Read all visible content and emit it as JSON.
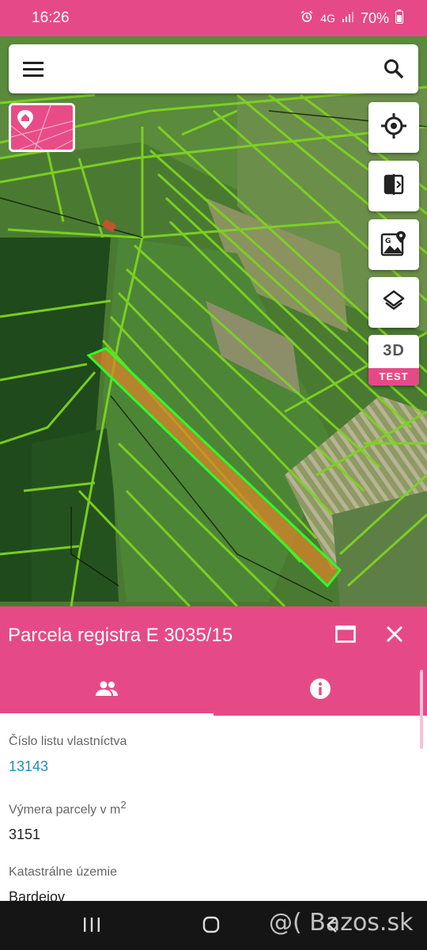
{
  "status_bar": {
    "time": "16:26",
    "network": "4G",
    "battery": "70%"
  },
  "search": {
    "menu_icon": "menu-icon",
    "search_icon": "search-icon"
  },
  "map_controls": {
    "locate_icon": "my-location-icon",
    "compare_icon": "compare-icon",
    "map_source_icon": "google-map-icon",
    "layers_icon": "layers-icon",
    "three_d_label": "3D",
    "three_d_badge": "TEST"
  },
  "panel": {
    "title": "Parcela registra E 3035/15",
    "maximize_icon": "maximize-icon",
    "close_icon": "close-icon",
    "tabs": [
      {
        "icon": "owners-icon",
        "active": true
      },
      {
        "icon": "info-icon",
        "active": false
      }
    ],
    "fields": [
      {
        "label": "Číslo listu vlastníctva",
        "value": "13143",
        "is_link": true
      },
      {
        "label": "Výmera parcely v m",
        "label_sup": "2",
        "value": "3151",
        "is_link": false
      },
      {
        "label": "Katastrálne územie",
        "value": "Bardejov",
        "is_link": false
      }
    ]
  },
  "watermark": "@( Bazos.sk",
  "colors": {
    "accent": "#e64a86",
    "link": "#1e8ec4",
    "parcel_outline": "#7ed321",
    "selected_parcel_fill": "#d9842a",
    "selected_parcel_stroke": "#2bff2b"
  }
}
